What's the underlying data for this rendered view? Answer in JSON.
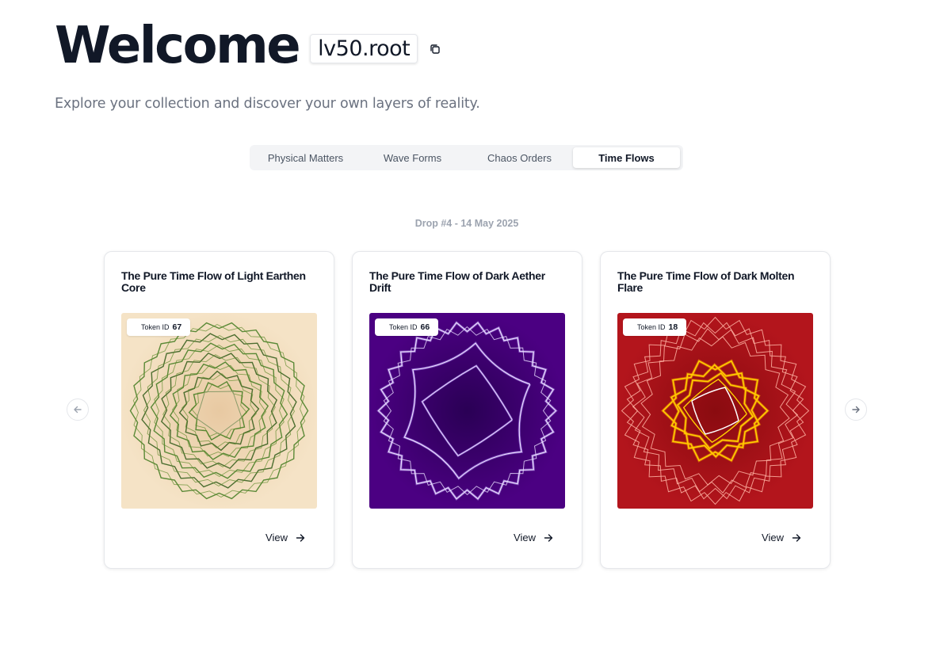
{
  "header": {
    "welcome": "Welcome",
    "username": "lv50.root"
  },
  "subtitle": "Explore your collection and discover your own layers of reality.",
  "tabs": [
    {
      "label": "Physical Matters",
      "active": false
    },
    {
      "label": "Wave Forms",
      "active": false
    },
    {
      "label": "Chaos Orders",
      "active": false
    },
    {
      "label": "Time Flows",
      "active": true
    }
  ],
  "drop_label": "Drop #4 - 14 May 2025",
  "cards": [
    {
      "title": "The Pure Time Flow of Light Earthen Core",
      "token_label": "Token ID",
      "token_id": "67",
      "view_label": "View",
      "colors": {
        "bg": "#f5e3c6",
        "line": "#3f7a1f"
      }
    },
    {
      "title": "The Pure Time Flow of Dark Aether Drift",
      "token_label": "Token ID",
      "token_id": "66",
      "view_label": "View",
      "colors": {
        "bg": "#4b0082",
        "line": "#e9ddff"
      }
    },
    {
      "title": "The Pure Time Flow of Dark Molten Flare",
      "token_label": "Token ID",
      "token_id": "18",
      "view_label": "View",
      "colors": {
        "bg": "#b3151c",
        "line": "#ffb3a3",
        "accent": "#ffd000"
      }
    }
  ]
}
